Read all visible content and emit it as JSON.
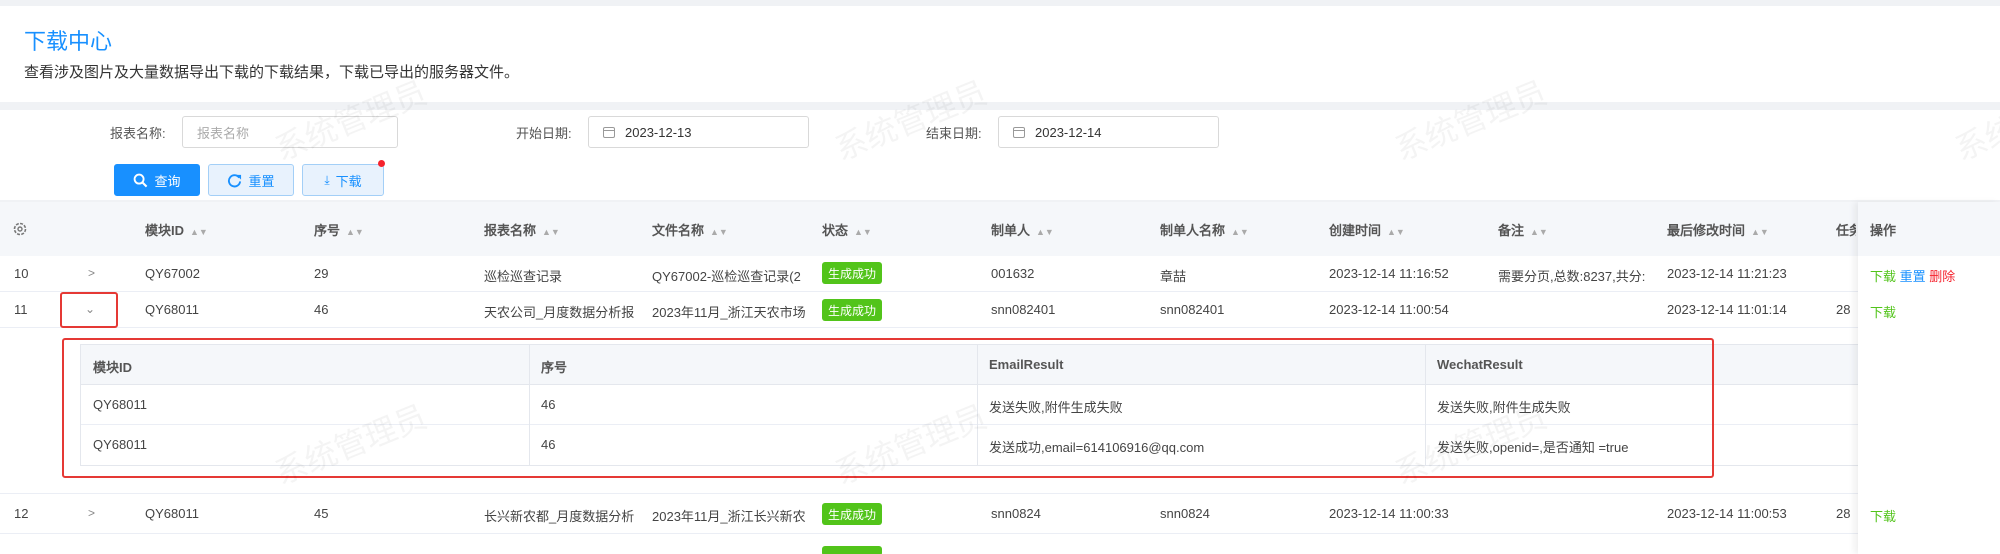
{
  "header": {
    "title": "下载中心",
    "description": "查看涉及图片及大量数据导出下载的下载结果，下载已导出的服务器文件。"
  },
  "filters": {
    "report_name_label": "报表名称:",
    "report_name_placeholder": "报表名称",
    "start_date_label": "开始日期:",
    "start_date_value": "2023-12-13",
    "end_date_label": "结束日期:",
    "end_date_value": "2023-12-14"
  },
  "buttons": {
    "query": "查询",
    "reset": "重置",
    "download": "下载"
  },
  "table": {
    "columns": [
      "模块ID",
      "序号",
      "报表名称",
      "文件名称",
      "状态",
      "制单人",
      "制单人名称",
      "创建时间",
      "备注",
      "最后修改时间",
      "任务",
      "操作"
    ],
    "rows": [
      {
        "index": "10",
        "module_id": "QY67002",
        "seq": "29",
        "report": "巡检巡查记录",
        "file": "QY67002-巡检巡查记录(2",
        "status": "生成成功",
        "creator": "001632",
        "creator_name": "章喆",
        "created": "2023-12-14 11:16:52",
        "remark": "需要分页,总数:8237,共分:",
        "modified": "2023-12-14 11:21:23",
        "task": "",
        "actions": [
          "下载",
          "重置",
          "删除"
        ]
      },
      {
        "index": "11",
        "module_id": "QY68011",
        "seq": "46",
        "report": "天农公司_月度数据分析报",
        "file": "2023年11月_浙江天农市场",
        "status": "生成成功",
        "creator": "snn082401",
        "creator_name": "snn082401",
        "created": "2023-12-14 11:00:54",
        "remark": "",
        "modified": "2023-12-14 11:01:14",
        "task": "28",
        "actions": [
          "下载"
        ]
      },
      {
        "index": "12",
        "module_id": "QY68011",
        "seq": "45",
        "report": "长兴新农都_月度数据分析",
        "file": "2023年11月_浙江长兴新农",
        "status": "生成成功",
        "creator": "snn0824",
        "creator_name": "snn0824",
        "created": "2023-12-14 11:00:33",
        "remark": "",
        "modified": "2023-12-14 11:00:53",
        "task": "28",
        "actions": [
          "下载"
        ]
      }
    ]
  },
  "subtable": {
    "columns": [
      "模块ID",
      "序号",
      "EmailResult",
      "WechatResult"
    ],
    "rows": [
      [
        "QY68011",
        "46",
        "发送失败,附件生成失败",
        "发送失败,附件生成失败"
      ],
      [
        "QY68011",
        "46",
        "发送成功,email=614106916@qq.com",
        "发送失败,openid=,是否通知 =true"
      ]
    ]
  },
  "watermark": "系统管理员",
  "colors": {
    "primary": "#1890ff",
    "success": "#52c41a",
    "danger": "#f5222d",
    "highlight": "#e53935"
  },
  "icons": [
    "settings-icon",
    "search-icon",
    "refresh-icon",
    "download-icon",
    "calendar-icon",
    "chevron-right-icon",
    "chevron-down-icon"
  ]
}
